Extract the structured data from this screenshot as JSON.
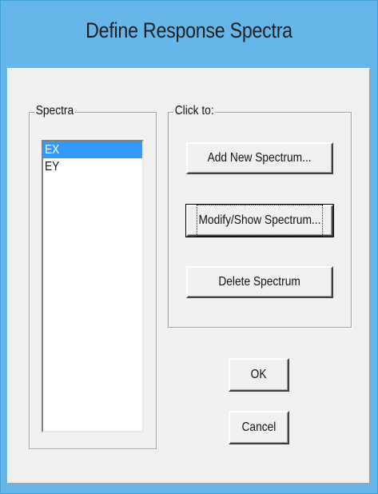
{
  "dialog": {
    "title": "Define Response Spectra"
  },
  "spectra_group": {
    "label": "Spectra",
    "items": [
      {
        "label": "EX",
        "selected": true
      },
      {
        "label": "EY",
        "selected": false
      }
    ]
  },
  "click_group": {
    "label": "Click to:",
    "add_label": "Add New Spectrum...",
    "modify_label": "Modify/Show Spectrum...",
    "delete_label": "Delete Spectrum"
  },
  "actions": {
    "ok_label": "OK",
    "cancel_label": "Cancel"
  },
  "colors": {
    "title_bar": "#67b6ea",
    "selection": "#3399ff",
    "dialog_face": "#f0f0f0"
  }
}
